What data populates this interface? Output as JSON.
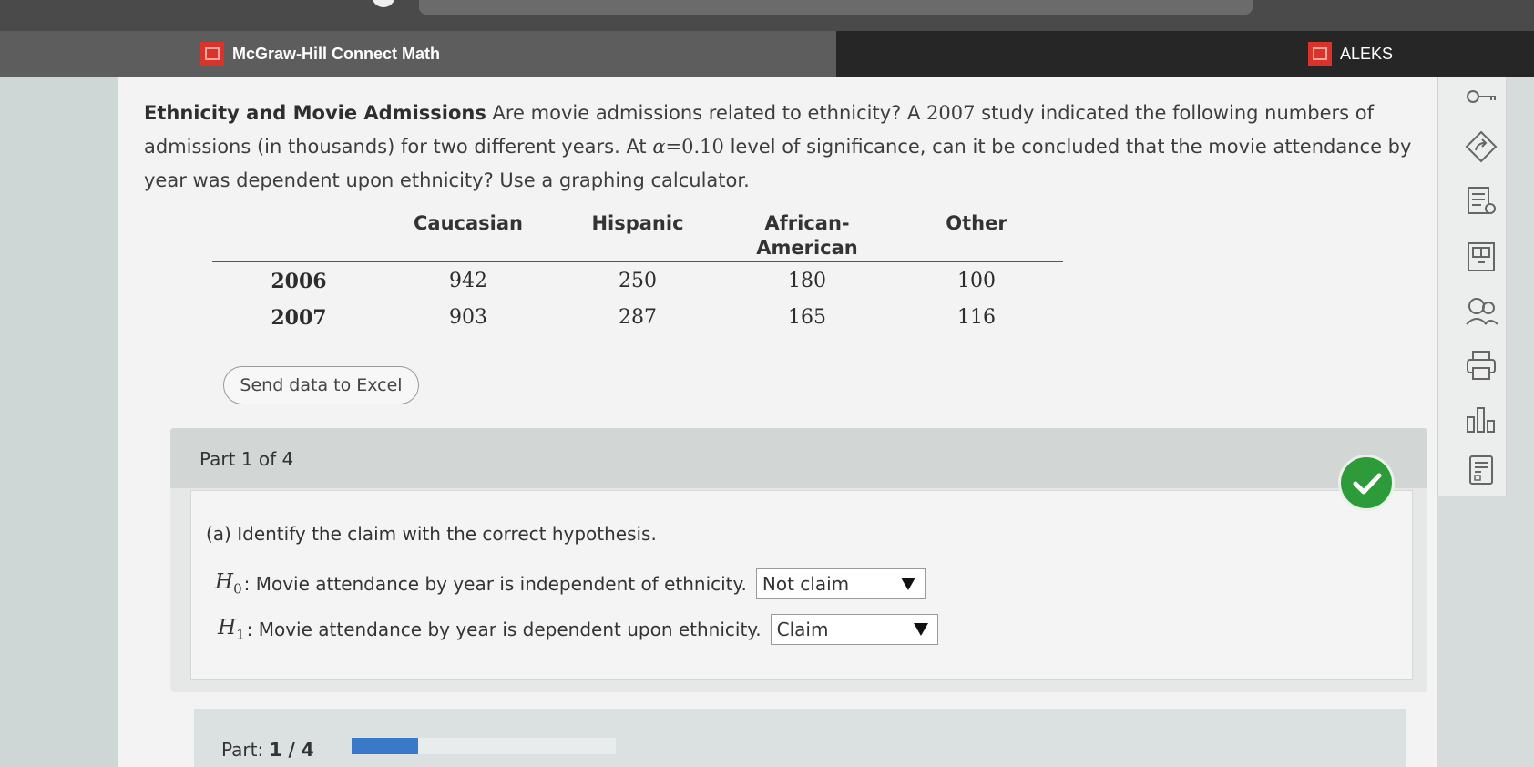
{
  "tabs": [
    {
      "label": "McGraw-Hill Connect Math"
    },
    {
      "label": "ALEKS"
    }
  ],
  "problem": {
    "title": "Ethnicity and Movie Admissions",
    "text_1": " Are movie admissions related to ethnicity? A ",
    "year": "2007",
    "text_2": " study indicated the following numbers of admissions (in thousands) for two different years. At ",
    "alpha": "α",
    "alpha_value": "=0.10",
    "text_3": " level of significance, can it be concluded that the movie attendance by year was dependent upon ethnicity? Use a graphing calculator."
  },
  "table": {
    "headers": [
      "Caucasian",
      "Hispanic",
      "African-\nAmerican",
      "Other"
    ],
    "rows": [
      {
        "year": "2006",
        "values": [
          "942",
          "250",
          "180",
          "100"
        ]
      },
      {
        "year": "2007",
        "values": [
          "903",
          "287",
          "165",
          "116"
        ]
      }
    ]
  },
  "excel_button": "Send data to Excel",
  "part": {
    "title": "Part 1 of 4",
    "question": "(a) Identify the claim with the correct hypothesis.",
    "h0_var": "H",
    "h0_sub": "0",
    "h0_text": ": Movie attendance by year is independent of ethnicity.",
    "h0_selected": "Not claim",
    "h1_var": "H",
    "h1_sub": "1",
    "h1_text": ": Movie attendance by year is dependent upon ethnicity.",
    "h1_selected": "Claim"
  },
  "progress": {
    "label": "Part: ",
    "current": "1",
    "sep": " / ",
    "total": "4",
    "fraction": 0.25
  },
  "colors": {
    "correct": "#2e9b3a",
    "progress": "#3a78c8",
    "brand_red": "#d9342b"
  },
  "tools": [
    "key-icon",
    "share-icon",
    "notes-icon",
    "calculator-icon",
    "help-person-icon",
    "print-icon",
    "stats-icon",
    "report-icon"
  ]
}
